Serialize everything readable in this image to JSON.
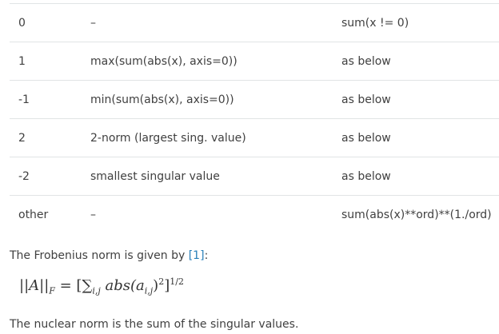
{
  "table": {
    "rows": [
      {
        "ord": "0",
        "matrix": "–",
        "vector": "sum(x != 0)"
      },
      {
        "ord": "1",
        "matrix": "max(sum(abs(x), axis=0))",
        "vector": "as below"
      },
      {
        "ord": "-1",
        "matrix": "min(sum(abs(x), axis=0))",
        "vector": "as below"
      },
      {
        "ord": "2",
        "matrix": "2-norm (largest sing. value)",
        "vector": "as below"
      },
      {
        "ord": "-2",
        "matrix": "smallest singular value",
        "vector": "as below"
      },
      {
        "ord": "other",
        "matrix": "–",
        "vector": "sum(abs(x)**ord)**(1./ord)"
      }
    ]
  },
  "frobenius": {
    "text": "The Frobenius norm is given by ",
    "link": "[1]",
    "suffix": ":"
  },
  "formula": {
    "lhs": "||A||",
    "lhs_sub": "F",
    "eq": " = [",
    "sum": "∑",
    "sum_sub": "i,j",
    "func": " abs(a",
    "func_sub": "i,j",
    "close": ")",
    "sq": "2",
    "bracket": "]",
    "pow": "1/2"
  },
  "nuclear": {
    "text": "The nuclear norm is the sum of the singular values."
  }
}
